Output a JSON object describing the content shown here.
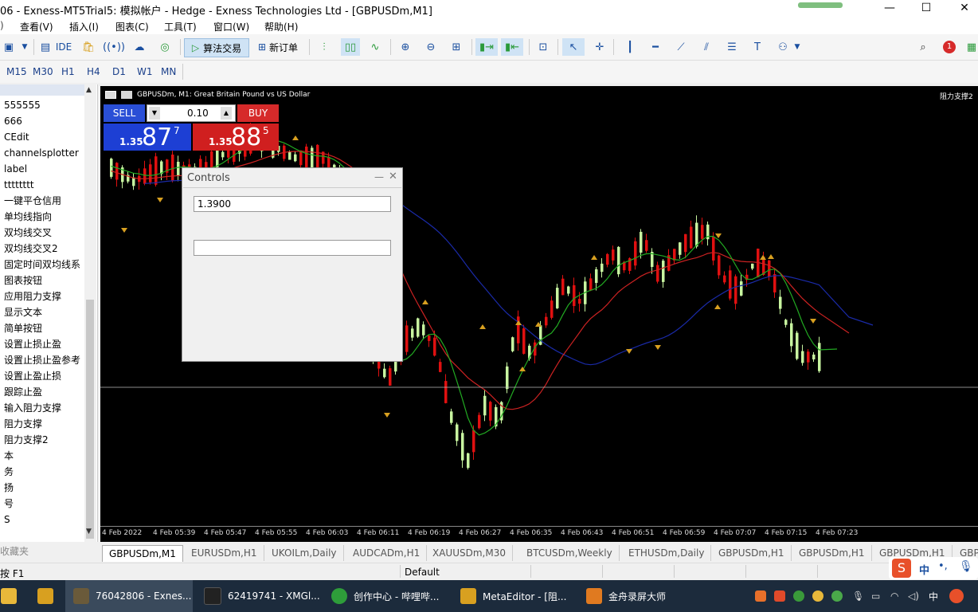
{
  "window": {
    "title": "06 - Exness-MT5Trial5: 模拟帐户 - Hedge - Exness Technologies Ltd - [GBPUSDm,M1]",
    "minimize": "—",
    "maximize": "☐",
    "close": "✕"
  },
  "menu": [
    "查看(V)",
    "插入(I)",
    "图表(C)",
    "工具(T)",
    "窗口(W)",
    "帮助(H)"
  ],
  "toolbar": {
    "ide": "IDE",
    "algo_trading": "算法交易",
    "new_order": "新订单",
    "notification_count": "1"
  },
  "timeframes": [
    "M15",
    "M30",
    "H1",
    "H4",
    "D1",
    "W1",
    "MN"
  ],
  "navigator": {
    "items": [
      "555555",
      "666",
      "CEdit",
      "channelsplotter",
      "label",
      "tttttttt",
      "一键平仓信用",
      "单均线指向",
      "双均线交叉",
      "双均线交叉2",
      "固定时间双均线系",
      "图表按钮",
      "应用阻力支撑",
      "显示文本",
      "简单按钮",
      "设置止损止盈",
      "设置止损止盈参考",
      "设置止盈止损",
      "跟踪止盈",
      "输入阻力支撑",
      "阻力支撑",
      "阻力支撑2",
      "本",
      "务",
      "扬",
      "号",
      "S"
    ],
    "footer": "收藏夹"
  },
  "chart": {
    "header": "GBPUSDm, M1:  Great Britain Pound vs US Dollar",
    "indicator_label": "阻力支撑2",
    "x_labels": [
      "4 Feb 2022",
      "4 Feb 05:39",
      "4 Feb 05:47",
      "4 Feb 05:55",
      "4 Feb 06:03",
      "4 Feb 06:11",
      "4 Feb 06:19",
      "4 Feb 06:27",
      "4 Feb 06:35",
      "4 Feb 06:43",
      "4 Feb 06:51",
      "4 Feb 06:59",
      "4 Feb 07:07",
      "4 Feb 07:15",
      "4 Feb 07:23"
    ],
    "colors": {
      "background": "#000000",
      "bull": "#c8f5a0",
      "bear": "#e01010",
      "ma_fast": "#22aa22",
      "ma_mid": "#cc2222",
      "ma_slow": "#1a2aa8",
      "arrow": "#d8a020"
    }
  },
  "trade_panel": {
    "sell_label": "SELL",
    "buy_label": "BUY",
    "lot": "0.10",
    "sell_prefix": "1.35",
    "sell_big": "87",
    "sell_sup": "7",
    "buy_prefix": "1.35",
    "buy_big": "88",
    "buy_sup": "5"
  },
  "controls_dialog": {
    "title": "Controls",
    "field1_value": "1.3900",
    "field2_value": ""
  },
  "chart_tabs": [
    "GBPUSDm,M1",
    "EURUSDm,H1",
    "UKOILm,Daily",
    "AUDCADm,H1",
    "XAUUSDm,M30",
    "BTCUSDm,Weekly",
    "ETHUSDm,Daily",
    "GBPUSDm,H1",
    "GBPUSDm,H1",
    "GBPUSDm,H1",
    "GBP"
  ],
  "status": {
    "help": "按 F1",
    "profile": "Default"
  },
  "taskbar": [
    {
      "label": "76042806 - Exnes...",
      "color": "#6a5a3a"
    },
    {
      "label": "62419741 - XMGl...",
      "color": "#222222"
    },
    {
      "label": "创作中心 - 哔哩哔...",
      "color": "#2e9d3a"
    },
    {
      "label": "MetaEditor - [阻...",
      "color": "#d8a020"
    },
    {
      "label": "金舟录屏大师",
      "color": "#e07a20"
    }
  ],
  "tray": {
    "ime": "中",
    "ime2": "中"
  }
}
